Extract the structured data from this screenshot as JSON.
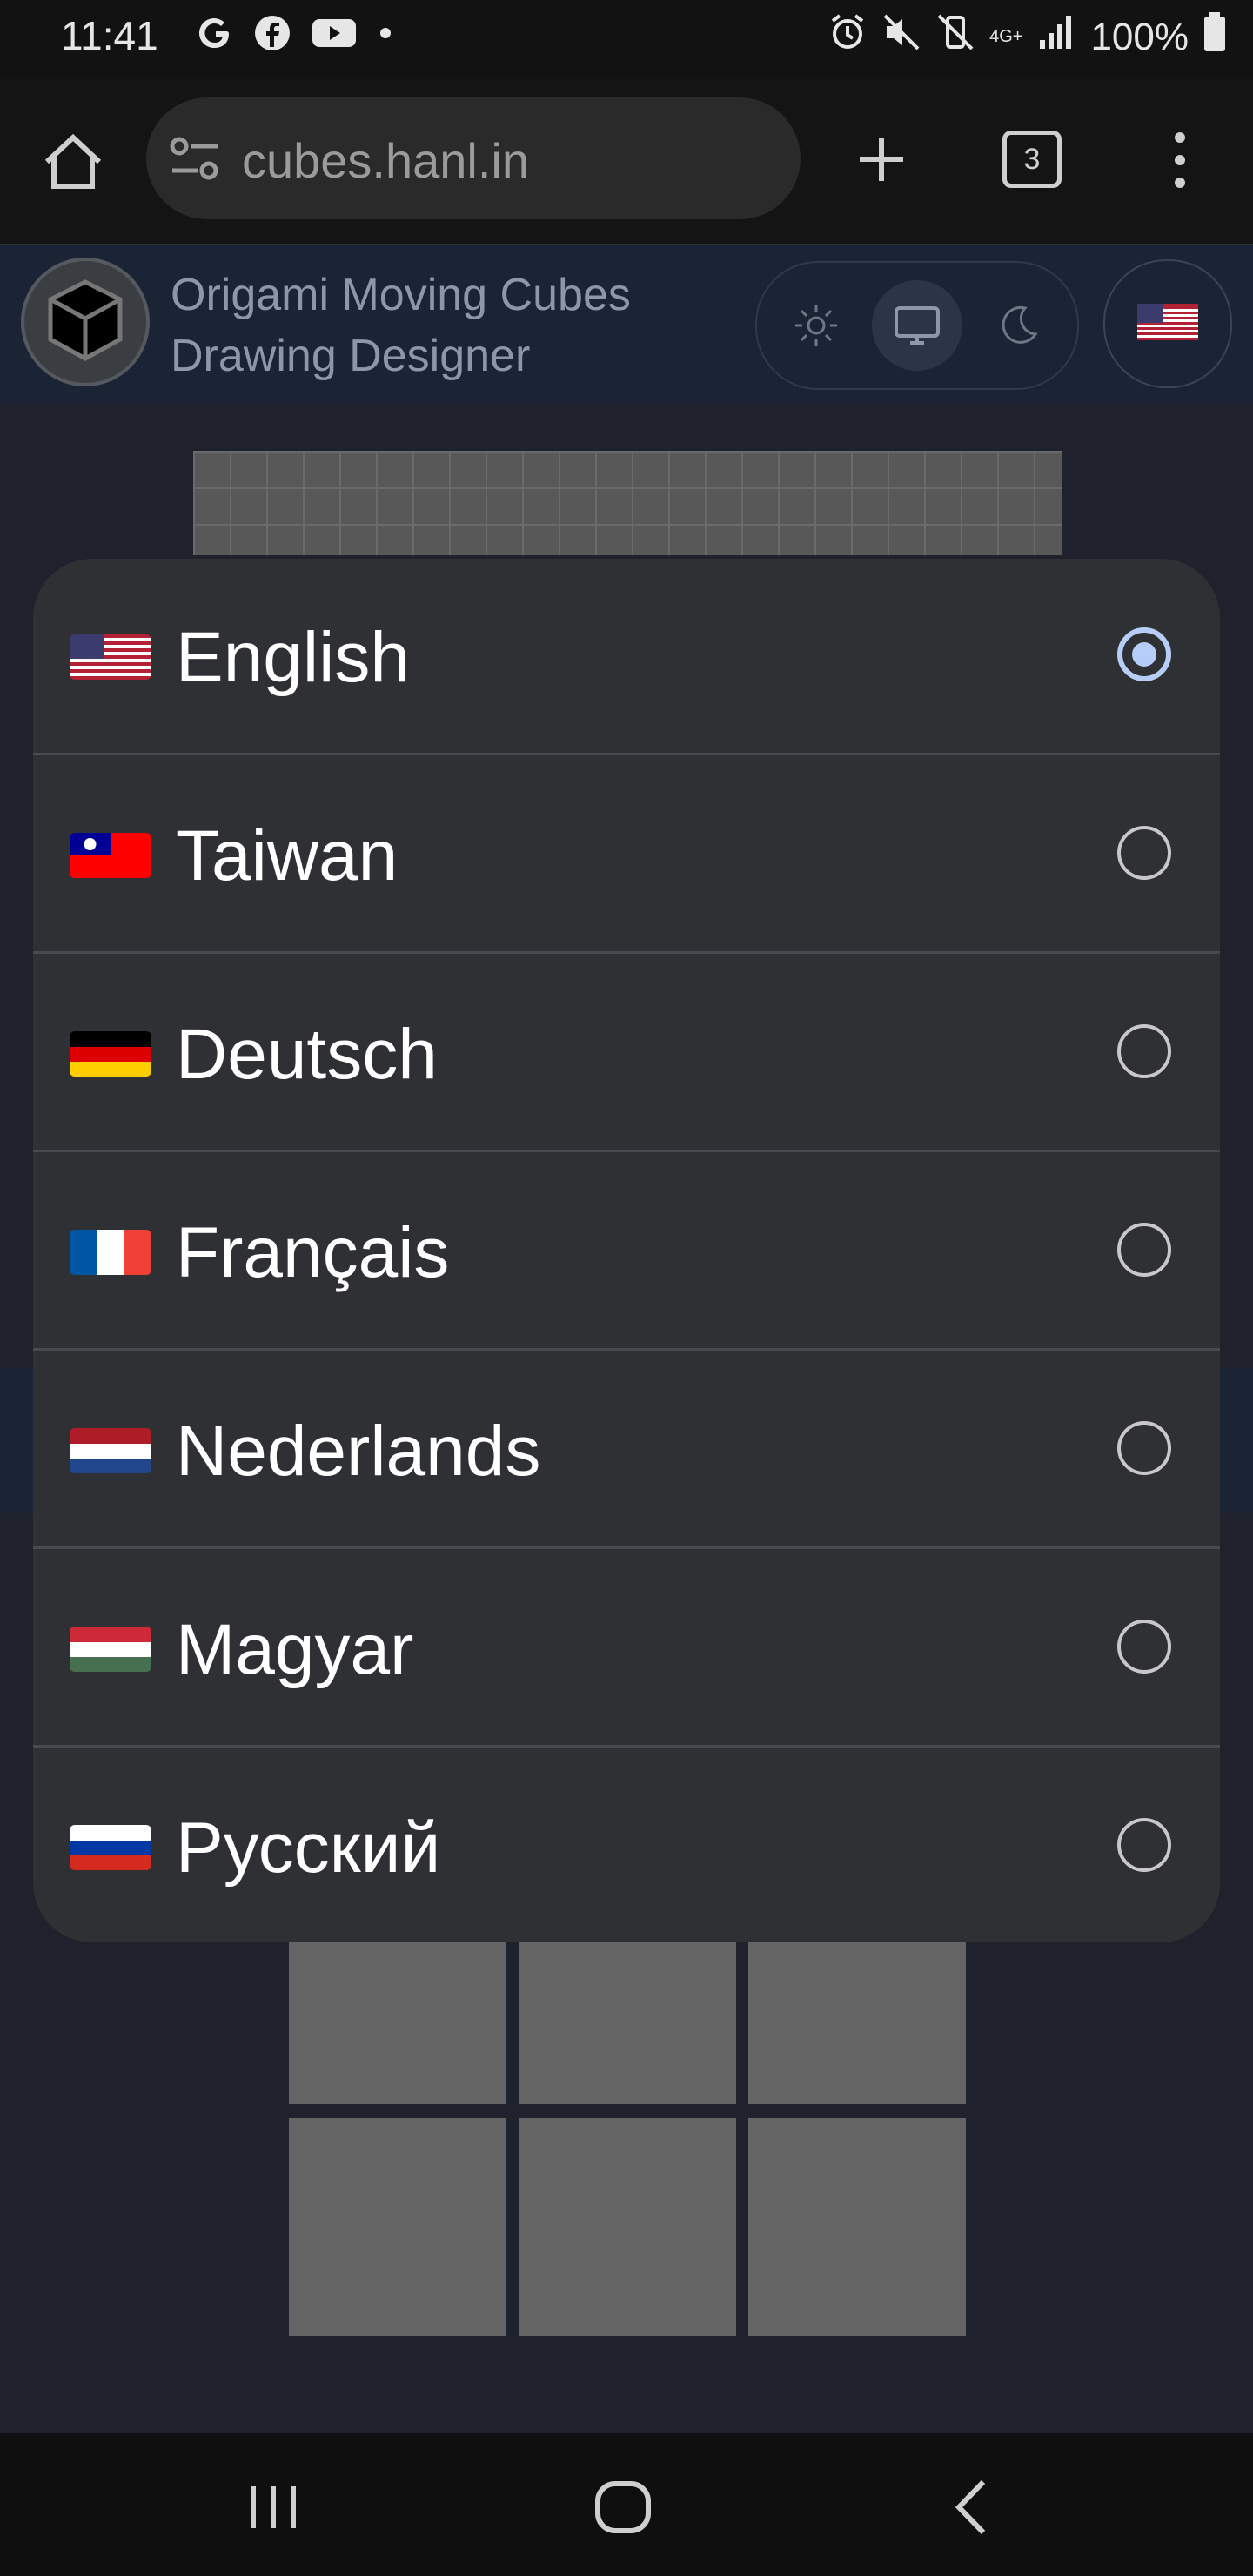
{
  "status_bar": {
    "time": "11:41",
    "battery": "100%",
    "network": "4G+",
    "left_icons": [
      "google-icon",
      "facebook-icon",
      "youtube-icon",
      "dot-icon"
    ],
    "right_icons": [
      "alarm-icon",
      "mute-icon",
      "vibrate-icon",
      "signal-icon",
      "battery-icon"
    ]
  },
  "browser": {
    "url": "cubes.hanl.in",
    "tab_count": "3"
  },
  "site": {
    "title_line1": "Origami Moving Cubes",
    "title_line2": "Drawing Designer",
    "theme_options": [
      "light",
      "system",
      "dark"
    ],
    "selected_theme": "system"
  },
  "language_dialog": {
    "options": [
      {
        "label": "English",
        "flag": "us",
        "selected": true
      },
      {
        "label": "Taiwan",
        "flag": "tw",
        "selected": false
      },
      {
        "label": "Deutsch",
        "flag": "de",
        "selected": false
      },
      {
        "label": "Français",
        "flag": "fr",
        "selected": false
      },
      {
        "label": "Nederlands",
        "flag": "nl",
        "selected": false
      },
      {
        "label": "Magyar",
        "flag": "hu",
        "selected": false
      },
      {
        "label": "Русский",
        "flag": "ru",
        "selected": false
      }
    ]
  },
  "colors": {
    "accent_radio": "#b6cdf7",
    "dialog_bg": "#2f3034",
    "page_bg": "#1f212c"
  }
}
